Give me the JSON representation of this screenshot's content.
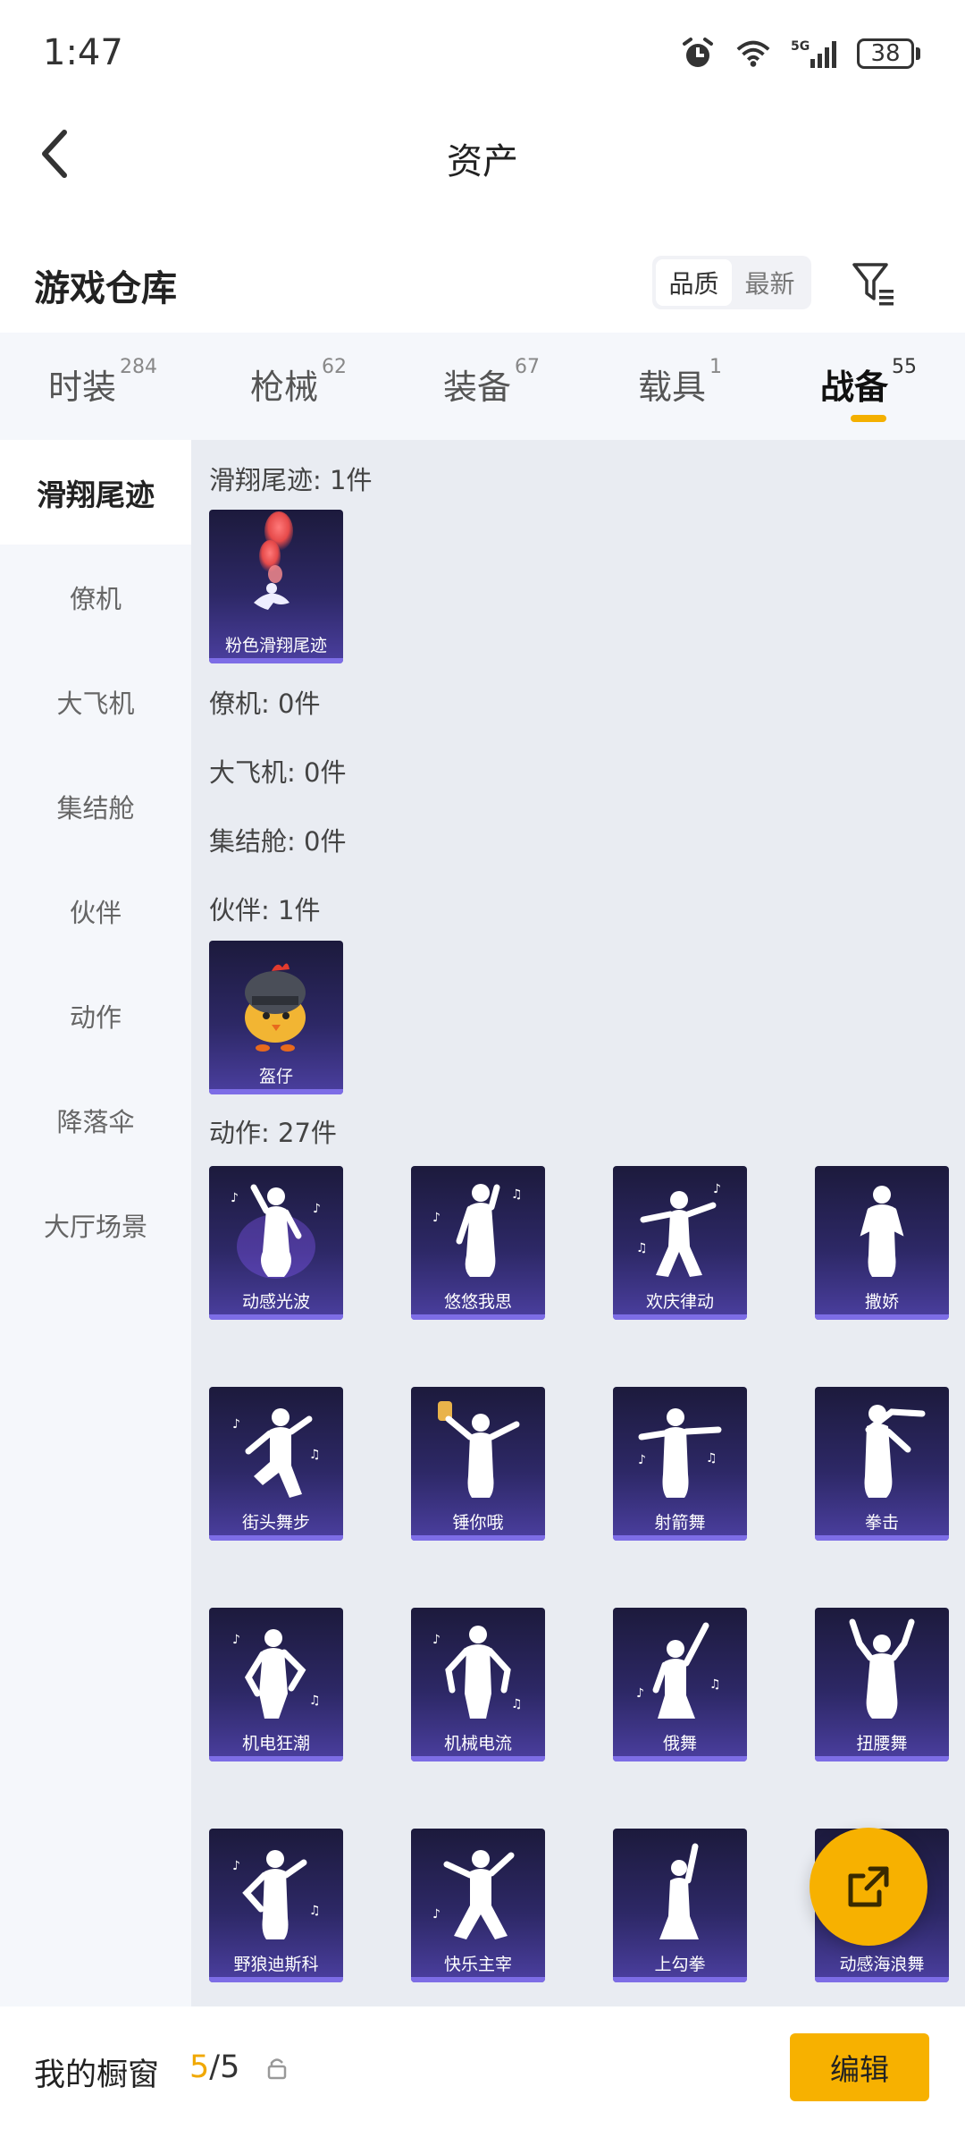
{
  "status_bar": {
    "time": "1:47",
    "battery": "38",
    "network": "5G"
  },
  "header": {
    "title": "资产"
  },
  "section": {
    "title": "游戏仓库",
    "sort_quality": "品质",
    "sort_newest": "最新"
  },
  "tabs": [
    {
      "label": "时装",
      "count": "284",
      "active": false
    },
    {
      "label": "枪械",
      "count": "62",
      "active": false
    },
    {
      "label": "装备",
      "count": "67",
      "active": false
    },
    {
      "label": "载具",
      "count": "1",
      "active": false
    },
    {
      "label": "战备",
      "count": "55",
      "active": true
    }
  ],
  "sidebar": {
    "items": [
      {
        "label": "滑翔尾迹",
        "active": true
      },
      {
        "label": "僚机",
        "active": false
      },
      {
        "label": "大飞机",
        "active": false
      },
      {
        "label": "集结舱",
        "active": false
      },
      {
        "label": "伙伴",
        "active": false
      },
      {
        "label": "动作",
        "active": false
      },
      {
        "label": "降落伞",
        "active": false
      },
      {
        "label": "大厅场景",
        "active": false
      }
    ]
  },
  "groups": {
    "trail": {
      "label": "滑翔尾迹: 1件",
      "items": [
        "粉色滑翔尾迹"
      ]
    },
    "wingman": {
      "label": "僚机: 0件"
    },
    "plane": {
      "label": "大飞机: 0件"
    },
    "pod": {
      "label": "集结舱: 0件"
    },
    "partner": {
      "label": "伙伴: 1件",
      "items": [
        "盔仔"
      ]
    },
    "emote": {
      "label": "动作: 27件",
      "items": [
        "动感光波",
        "悠悠我思",
        "欢庆律动",
        "撒娇",
        "街头舞步",
        "锤你哦",
        "射箭舞",
        "拳击",
        "机电狂潮",
        "机械电流",
        "俄舞",
        "扭腰舞",
        "野狼迪斯科",
        "快乐主宰",
        "上勾拳",
        "动感海浪舞"
      ]
    }
  },
  "bottom_bar": {
    "label": "我的橱窗",
    "current": "5",
    "total": "/5",
    "edit_label": "编辑"
  },
  "colors": {
    "accent": "#f7b100",
    "card_top": "#1c1a3c",
    "card_bottom": "#4b3fa0",
    "content_bg": "#e9ecf2"
  }
}
